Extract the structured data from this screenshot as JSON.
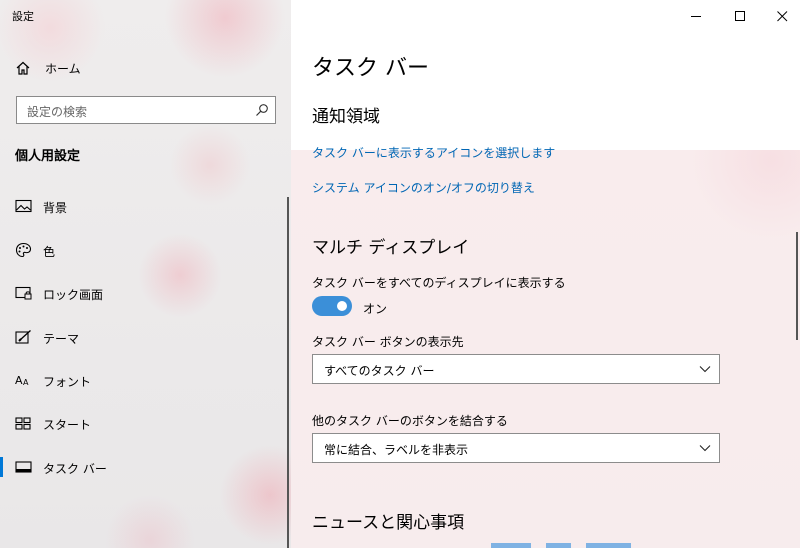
{
  "window": {
    "title": "設定",
    "controls": {
      "minimize": "minimize",
      "maximize": "maximize",
      "close": "close"
    }
  },
  "sidebar": {
    "home_label": "ホーム",
    "search_placeholder": "設定の検索",
    "section_title": "個人用設定",
    "items": [
      {
        "label": "背景",
        "icon": "picture-icon"
      },
      {
        "label": "色",
        "icon": "palette-icon"
      },
      {
        "label": "ロック画面",
        "icon": "lock-screen-icon"
      },
      {
        "label": "テーマ",
        "icon": "theme-icon"
      },
      {
        "label": "フォント",
        "icon": "font-icon"
      },
      {
        "label": "スタート",
        "icon": "start-icon"
      },
      {
        "label": "タスク バー",
        "icon": "taskbar-icon",
        "selected": true
      }
    ]
  },
  "main": {
    "page_title": "タスク バー",
    "notification_area": {
      "heading": "通知領域",
      "link_select_icons": "タスク バーに表示するアイコンを選択します",
      "link_system_icons": "システム アイコンのオン/オフの切り替え"
    },
    "multi_display": {
      "heading": "マルチ ディスプレイ",
      "show_on_all_label": "タスク バーをすべてのディスプレイに表示する",
      "toggle_state": "オン",
      "toggle_on": true,
      "buttons_location_label": "タスク バー ボタンの表示先",
      "buttons_location_value": "すべてのタスク バー",
      "combine_label": "他のタスク バーのボタンを結合する",
      "combine_value": "常に結合、ラベルを非表示"
    },
    "news_heading": "ニュースと関心事項"
  },
  "colors": {
    "accent": "#0078d7",
    "link": "#0066b4",
    "toggle_on": "#3b8fd8"
  }
}
